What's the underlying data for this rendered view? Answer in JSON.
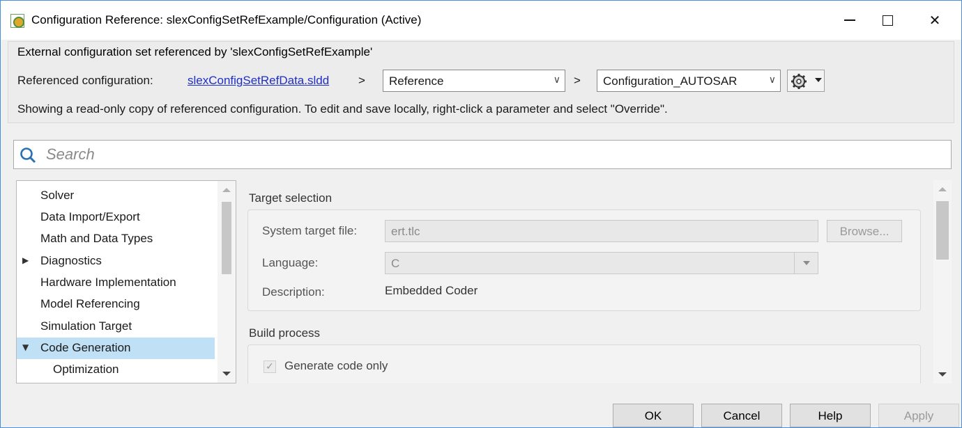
{
  "window": {
    "title": "Configuration Reference: slexConfigSetRefExample/Configuration (Active)",
    "minimize_glyph": "—",
    "maximize_glyph": "☐",
    "close_glyph": "✕"
  },
  "reference": {
    "group_title": "External configuration set referenced by 'slexConfigSetRefExample'",
    "label": "Referenced configuration:",
    "file_link": "slexConfigSetRefData.sldd",
    "separator": ">",
    "reference_selected": "Reference",
    "configuration_selected": "Configuration_AUTOSAR",
    "note": "Showing a read-only copy of referenced configuration. To edit and save locally, right-click a parameter and select \"Override\".",
    "gear_icon": "gear-icon"
  },
  "search": {
    "placeholder": "Search",
    "icon": "search-icon"
  },
  "tree": {
    "items": [
      {
        "label": "Solver"
      },
      {
        "label": "Data Import/Export"
      },
      {
        "label": "Math and Data Types"
      },
      {
        "label": "Diagnostics",
        "caret": "▶"
      },
      {
        "label": "Hardware Implementation"
      },
      {
        "label": "Model Referencing"
      },
      {
        "label": "Simulation Target"
      },
      {
        "label": "Code Generation",
        "caret": "▼"
      },
      {
        "label": "Optimization"
      }
    ]
  },
  "target_selection": {
    "heading": "Target selection",
    "system_target_label": "System target file:",
    "system_target_value": "ert.tlc",
    "browse_label": "Browse...",
    "language_label": "Language:",
    "language_value": "C",
    "description_label": "Description:",
    "description_value": "Embedded Coder"
  },
  "build_process": {
    "heading": "Build process",
    "generate_code_only_label": "Generate code only",
    "checkmark": "✓"
  },
  "footer": {
    "ok": "OK",
    "cancel": "Cancel",
    "help": "Help",
    "apply": "Apply"
  },
  "colors": {
    "link": "#1f2ec4",
    "selection": "#bfe0f5",
    "window_border": "#4a90d9"
  }
}
